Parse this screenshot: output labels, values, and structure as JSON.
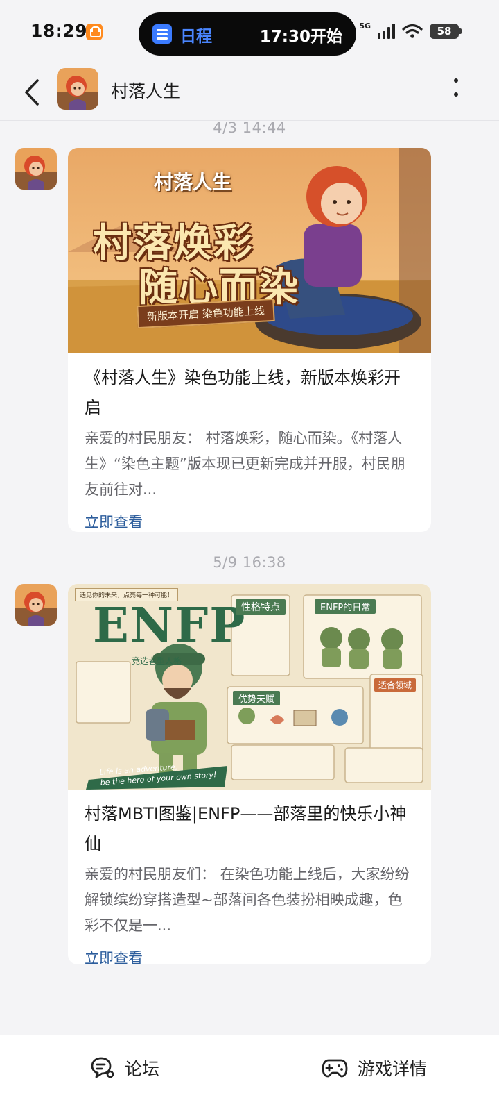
{
  "status_bar": {
    "time": "18:29",
    "island_title": "日程",
    "island_time": "17:30开始",
    "network": "5G",
    "battery": "58"
  },
  "header": {
    "title": "村落人生"
  },
  "messages": [
    {
      "timestamp": "4/3  14:44",
      "image": {
        "logo_text": "村落人生",
        "headline_1": "村落焕彩",
        "headline_2": "随心而染",
        "ribbon": "新版本开启 染色功能上线"
      },
      "title": "《村落人生》染色功能上线，新版本焕彩开启",
      "desc": "亲爱的村民朋友： 村落焕彩，随心而染。《村落人生》“染色主题”版本现已更新完成并开服，村民朋友前往对...",
      "link": "立即查看"
    },
    {
      "timestamp": "5/9  16:38",
      "image": {
        "tag": "遇见你的未来，点亮每一种可能！",
        "big_title": "ENFP",
        "subtitle": "竞选者型人格",
        "box_traits_title": "性格特点",
        "box_daily_title": "ENFP的日常",
        "box_strength_title": "优势天赋",
        "box_field_title": "适合领域",
        "slogan_1": "Life is an adventure,",
        "slogan_2": "be the hero of your own story!"
      },
      "title": "村落MBTI图鉴|ENFP——部落里的快乐小神仙",
      "desc": "亲爱的村民朋友们： 在染色功能上线后，大家纷纷解锁缤纷穿搭造型~部落间各色装扮相映成趣，色彩不仅是一...",
      "link": "立即查看"
    }
  ],
  "bottom_nav": {
    "forum": "论坛",
    "game_details": "游戏详情"
  },
  "colors": {
    "link": "#2c5d9c",
    "island_accent": "#4a86ff",
    "page_bg": "#f4f4f6"
  }
}
